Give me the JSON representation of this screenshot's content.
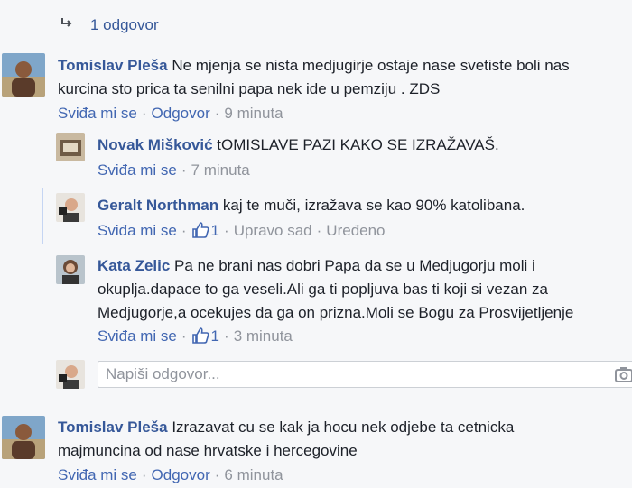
{
  "replies_toggle": {
    "arrow_icon": "reply-arrow-icon",
    "label": "1 odgovor"
  },
  "comments": [
    {
      "author": "Tomislav Pleša",
      "text_lines": [
        "Ne mjenja se nista medjugirje ostaje nase svetiste boli nas",
        "kurcina sto prica ta senilni papa nek ide u pemziju . ZDS"
      ],
      "like_label": "Sviđa mi se",
      "reply_label": "Odgovor",
      "time": "9 minuta",
      "replies": [
        {
          "author": "Novak Mišković",
          "text_lines": [
            "tOMISLAVE PAZI KAKO SE IZRAŽAVAŠ."
          ],
          "like_label": "Sviđa mi se",
          "time": "7 minuta"
        },
        {
          "author": "Geralt Northman",
          "text_lines": [
            "kaj te muči, izražava se kao 90% katolibana."
          ],
          "like_label": "Sviđa mi se",
          "likes": "1",
          "time": "Upravo sad",
          "edited": "Uređeno"
        },
        {
          "author": "Kata Zelic",
          "text_lines": [
            "Pa ne brani nas dobri Papa da se u Medjugorju moli i",
            "okuplja.dapace to ga veseli.Ali ga ti popljuva bas ti koji si vezan za",
            "Medjugorje,a ocekujes da ga on prizna.Moli se Bogu za Prosvijetljenje"
          ],
          "like_label": "Sviđa mi se",
          "likes": "1",
          "time": "3 minuta"
        }
      ]
    },
    {
      "author": "Tomislav Pleša",
      "text_lines": [
        "Izrazavat cu se kak ja hocu nek odjebe ta cetnicka",
        "majmuncina od nase hrvatske i hercegovine"
      ],
      "like_label": "Sviđa mi se",
      "reply_label": "Odgovor",
      "time": "6 minuta"
    }
  ],
  "reply_input": {
    "placeholder": "Napiši odgovor...",
    "camera_icon": "camera-icon"
  },
  "colors": {
    "link": "#365899",
    "action": "#4267b2",
    "meta": "#90949c",
    "thread": "#c5d5f3",
    "background": "#f6f7f9"
  }
}
